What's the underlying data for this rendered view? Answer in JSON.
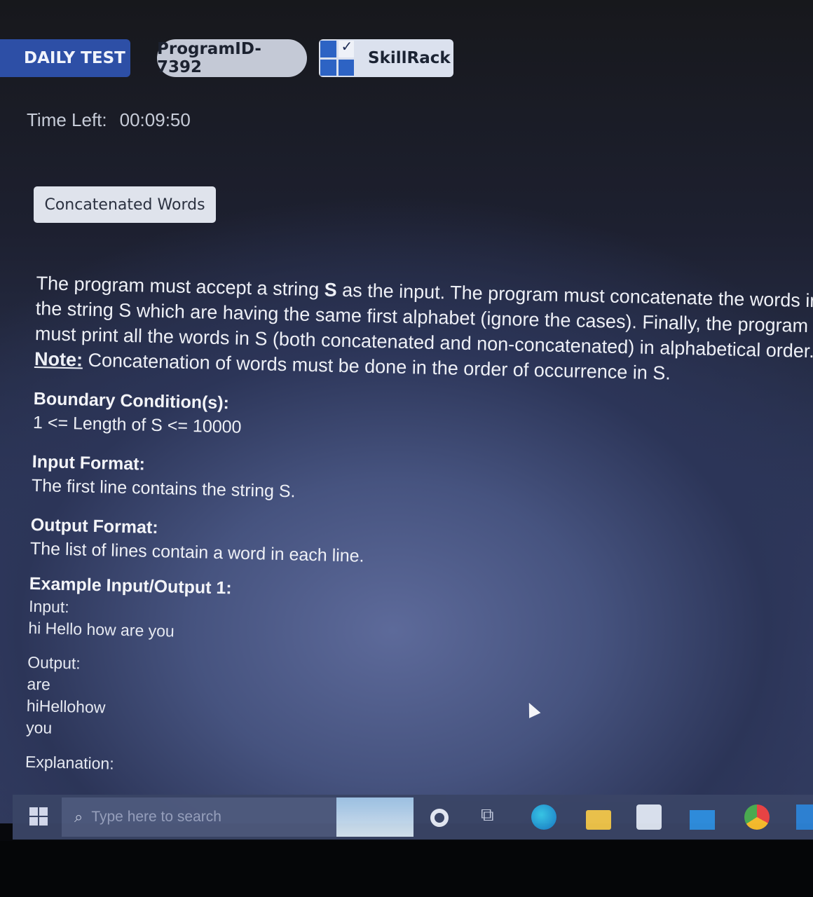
{
  "header": {
    "daily_test": "DAILY TEST",
    "program_id": "ProgramID- 7392",
    "brand": "SkillRack"
  },
  "timer": {
    "label": "Time Left:",
    "value": "00:09:50"
  },
  "problem": {
    "title": "Concatenated Words",
    "statement_lines": [
      "The program must accept a string ",
      "S",
      " as the input. The program must concatenate the words in",
      "the string S which are having the same first alphabet (ignore the cases). Finally, the program",
      "must print all the words in S (both concatenated and non-concatenated) in alphabetical order.",
      "Note:",
      " Concatenation of words must be done in the order of occurrence in S."
    ],
    "boundary_heading": "Boundary Condition(s):",
    "boundary_text": "1 <= Length of S <= 10000",
    "input_format_heading": "Input Format:",
    "input_format_text": "The first line contains the string S.",
    "output_format_heading": "Output Format:",
    "output_format_text": "The list of lines contain a word in each line.",
    "example_heading": "Example Input/Output 1:",
    "input_label": "Input:",
    "input_value": "hi Hello how are you",
    "output_label": "Output:",
    "output_lines": [
      "are",
      "hiHellohow",
      "you"
    ],
    "explanation_label": "Explanation:"
  },
  "taskbar": {
    "search_placeholder": "Type here to search",
    "icons": [
      "windows-start-icon",
      "search-icon",
      "cortana-icon",
      "task-view-icon",
      "edge-icon",
      "file-explorer-icon",
      "store-icon",
      "mail-icon",
      "chrome-icon",
      "app-icon"
    ]
  }
}
